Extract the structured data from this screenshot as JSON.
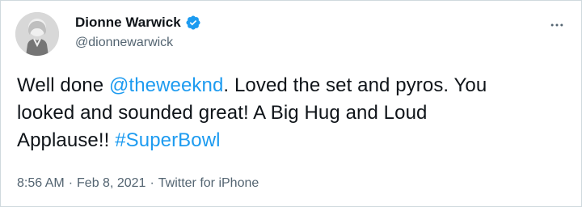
{
  "author": {
    "display_name": "Dionne Warwick",
    "handle": "@dionnewarwick",
    "verified_icon": "verified-badge-icon"
  },
  "tweet": {
    "line1_prefix": "Well done ",
    "mention": "@theweeknd",
    "line1_suffix": ".  Loved the set and pyros.  You",
    "line2": "looked and sounded great!  A Big Hug and Loud",
    "line3_prefix": "Applause!! ",
    "hashtag": "#SuperBowl"
  },
  "meta": {
    "time": "8:56 AM",
    "date": "Feb 8, 2021",
    "source": "Twitter for iPhone",
    "separator": "·"
  },
  "colors": {
    "link": "#1d9bf0",
    "text": "#0f1419",
    "secondary": "#536471",
    "border": "#cfd9de"
  },
  "icons": {
    "more": "more-icon",
    "avatar": "avatar-image"
  }
}
